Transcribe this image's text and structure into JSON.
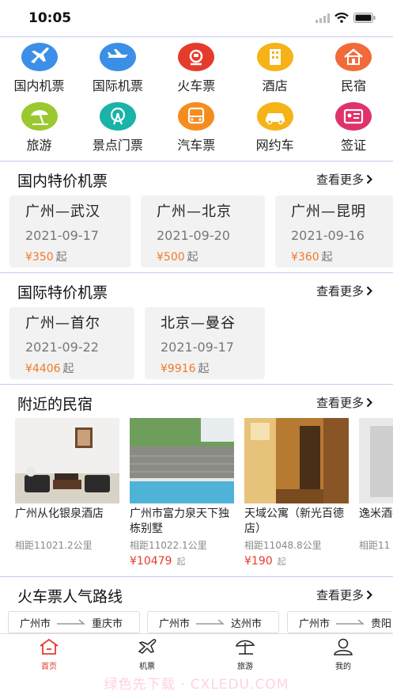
{
  "status": {
    "time": "10:05"
  },
  "categories": [
    {
      "label": "国内机票",
      "icon": "plane-icon",
      "color": "#3b8fe6"
    },
    {
      "label": "国际机票",
      "icon": "intl-plane-icon",
      "color": "#3b8fe6"
    },
    {
      "label": "火车票",
      "icon": "train-icon",
      "color": "#e53b2c"
    },
    {
      "label": "酒店",
      "icon": "hotel-icon",
      "color": "#f5b318"
    },
    {
      "label": "民宿",
      "icon": "homestay-icon",
      "color": "#f26a3a"
    },
    {
      "label": "旅游",
      "icon": "beach-umbrella-icon",
      "color": "#9ac92f"
    },
    {
      "label": "景点门票",
      "icon": "ferris-wheel-icon",
      "color": "#19b3a8"
    },
    {
      "label": "汽车票",
      "icon": "bus-icon",
      "color": "#f58c1f"
    },
    {
      "label": "网约车",
      "icon": "car-icon",
      "color": "#f5b318"
    },
    {
      "label": "签证",
      "icon": "id-card-icon",
      "color": "#e0336b"
    }
  ],
  "domestic": {
    "title": "国内特价机票",
    "more": "查看更多",
    "fares": [
      {
        "route": "广州—武汉",
        "date": "2021-09-17",
        "price": "¥350",
        "suffix": "起"
      },
      {
        "route": "广州—北京",
        "date": "2021-09-20",
        "price": "¥500",
        "suffix": "起"
      },
      {
        "route": "广州—昆明",
        "date": "2021-09-16",
        "price": "¥360",
        "suffix": "起"
      }
    ]
  },
  "international": {
    "title": "国际特价机票",
    "more": "查看更多",
    "fares": [
      {
        "route": "广州—首尔",
        "date": "2021-09-22",
        "price": "¥4406",
        "suffix": "起"
      },
      {
        "route": "北京—曼谷",
        "date": "2021-09-17",
        "price": "¥9916",
        "suffix": "起"
      }
    ]
  },
  "homestays": {
    "title": "附近的民宿",
    "more": "查看更多",
    "items": [
      {
        "name": "广州从化银泉酒店",
        "distance": "相距11021.2公里",
        "price": "",
        "suffix": ""
      },
      {
        "name": "广州市富力泉天下独栋别墅",
        "distance": "相距11022.1公里",
        "price": "¥10479",
        "suffix": "起"
      },
      {
        "name": "天域公寓（新光百德店）",
        "distance": "相距11048.8公里",
        "price": "¥190",
        "suffix": "起"
      },
      {
        "name": "逸米酒都北京",
        "distance": "相距11",
        "price": "",
        "suffix": ""
      }
    ]
  },
  "trains": {
    "title": "火车票人气路线",
    "more": "查看更多",
    "routes": [
      {
        "from": "广州市",
        "to": "重庆市"
      },
      {
        "from": "广州市",
        "to": "达州市"
      },
      {
        "from": "广州市",
        "to": "贵阳"
      }
    ]
  },
  "tabbar": [
    {
      "label": "首页",
      "icon": "home-icon",
      "active": true
    },
    {
      "label": "机票",
      "icon": "plane-tab-icon",
      "active": false
    },
    {
      "label": "旅游",
      "icon": "beach-tab-icon",
      "active": false
    },
    {
      "label": "我的",
      "icon": "user-icon",
      "active": false
    }
  ],
  "watermark": "绿色先下载 · CXLEDU.COM",
  "colors": {
    "accent": "#e23b2e",
    "price": "#f07a2b",
    "divider": "#c6cbef"
  }
}
